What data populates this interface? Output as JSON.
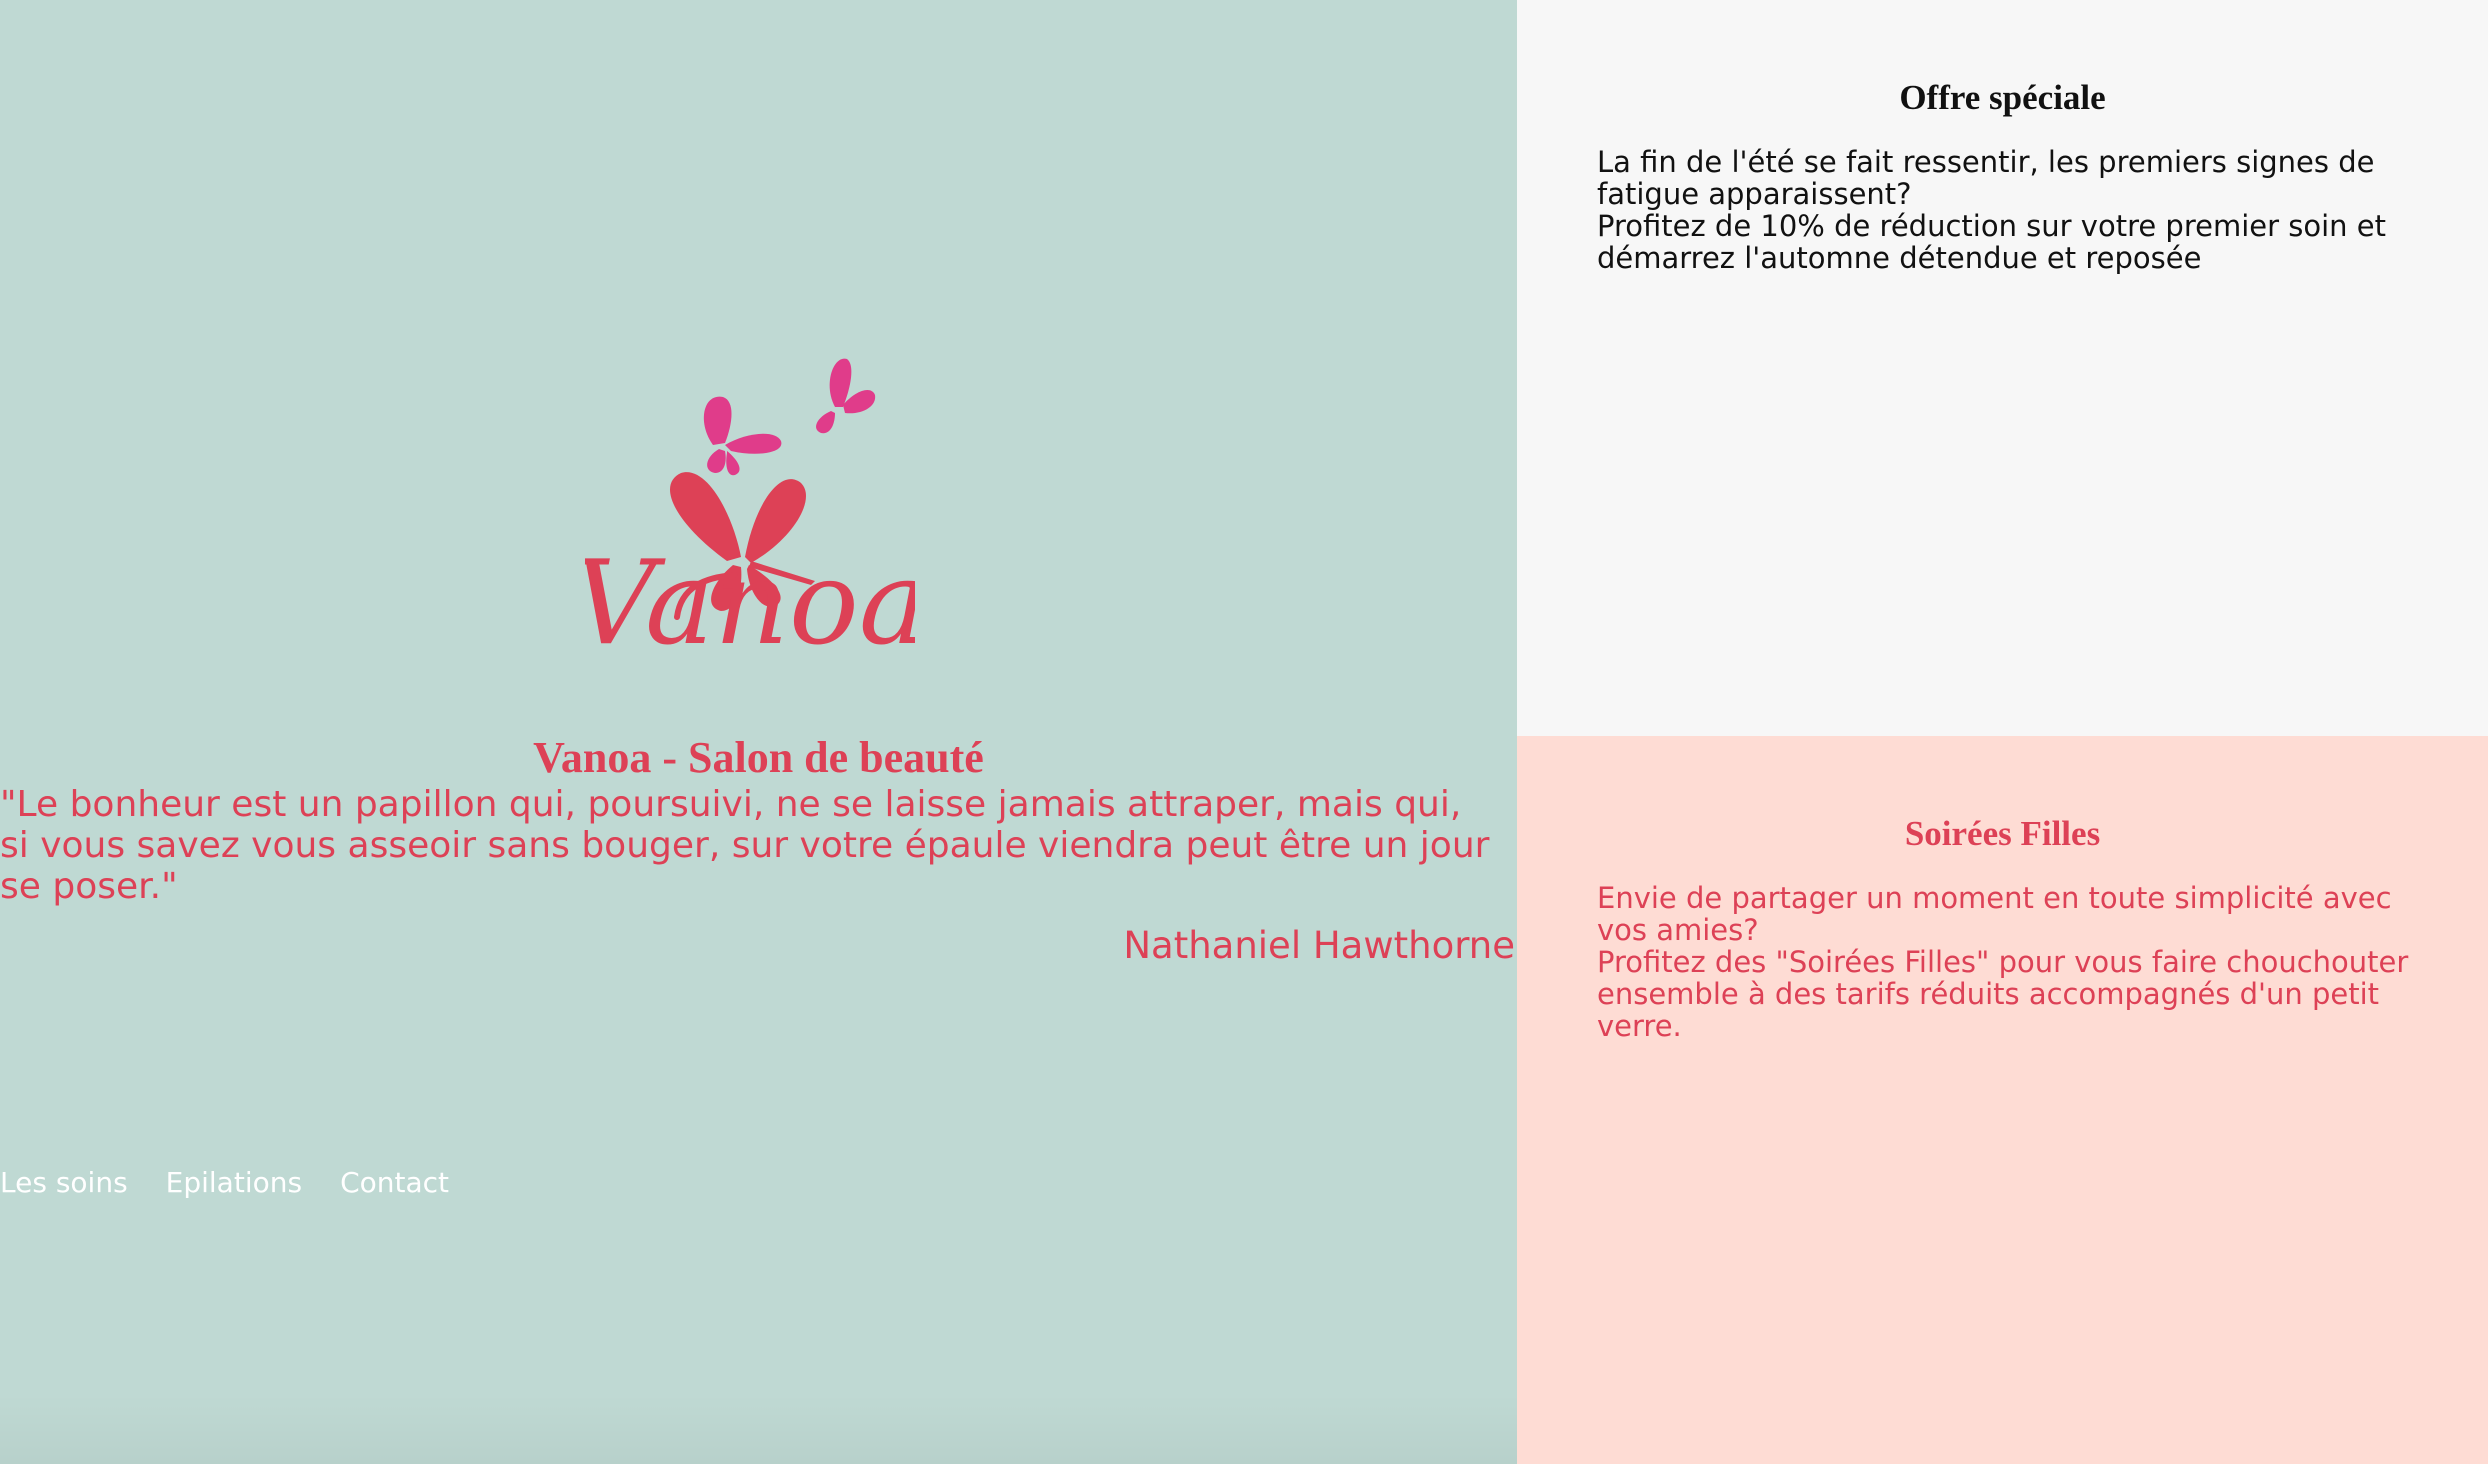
{
  "colors": {
    "left_bg": "#bfd9d3",
    "offer_bg": "#f7f7f7",
    "soiree_bg": "#fedcd4",
    "accent": "#dd4156",
    "butterfly_pink": "#e03c8a",
    "nav_text": "#ffffff"
  },
  "hero": {
    "logo_text": "Vanoa",
    "logo_icon": "butterfly-icon",
    "title": "Vanoa - Salon de beauté",
    "quote": "\"Le bonheur est un papillon qui, poursuivi, ne se laisse jamais attraper, mais qui, si vous savez vous asseoir sans bouger, sur votre épaule viendra peut être un jour se poser.\"",
    "author": "Nathaniel Hawthorne"
  },
  "nav": {
    "items": [
      "Les soins",
      "Epilations",
      "Contact"
    ]
  },
  "offer": {
    "title": "Offre spéciale",
    "line1": "La fin de l'été se fait ressentir, les premiers signes de fatigue apparaissent?",
    "line2": "Profitez de 10% de réduction sur votre premier soin et démarrez l'automne détendue et reposée"
  },
  "soirees": {
    "title": "Soirées Filles",
    "line1": "Envie de partager un moment en toute simplicité avec vos amies?",
    "line2": "Profitez des \"Soirées Filles\" pour vous faire chouchouter ensemble à des tarifs réduits accompagnés d'un petit verre."
  }
}
